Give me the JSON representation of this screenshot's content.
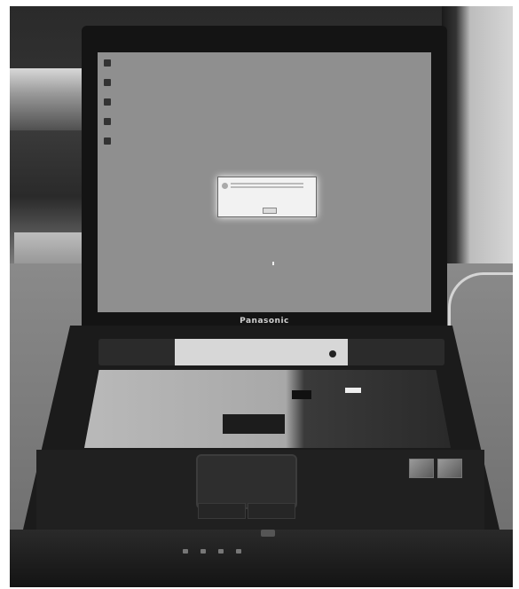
{
  "photo": {
    "subject": "",
    "screen": {
      "desktop_icons": [
        "",
        "",
        "",
        "",
        ""
      ],
      "dialog": {
        "title": ""
      }
    },
    "brand_text": "Panasonic"
  }
}
